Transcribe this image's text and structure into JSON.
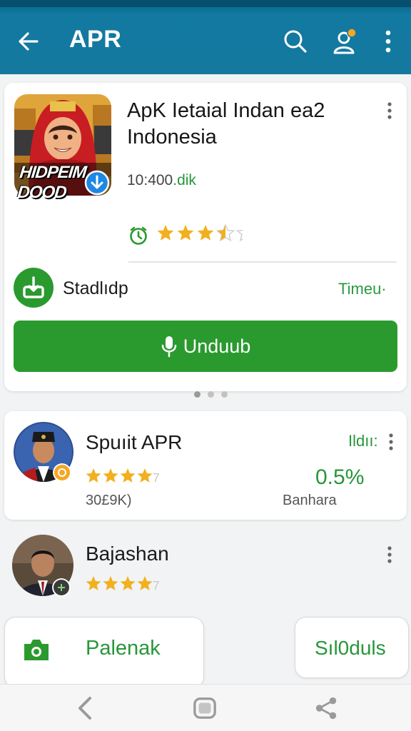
{
  "appbar": {
    "title": "APR",
    "icons": [
      "back-arrow-icon",
      "search-icon",
      "account-icon",
      "more-vert-icon"
    ],
    "color": "#15799f",
    "notification_dot_color": "#f5a623"
  },
  "app_card": {
    "icon_text": "HIDPEIM DOOD",
    "title": "ApK Ietaial Indan ea2 Indonesia",
    "size_number": "10:400",
    "size_suffix": ".dik",
    "rating_stars": 3.5,
    "download_label": "Stadlıdp",
    "time_label": "Timeu·",
    "button_label": "Unduub",
    "accent": "#2a9a2f"
  },
  "pager": {
    "count": 3,
    "active": 0
  },
  "publishers": [
    {
      "name": "Spuıit APR",
      "rating_stars": 4,
      "rating_suffix": "7",
      "count": "30£9K)",
      "tag": "Ildıı:",
      "percent": "0.5%",
      "source": "Banhara"
    },
    {
      "name": "Bajashan",
      "rating_stars": 4,
      "rating_suffix": "7"
    }
  ],
  "chips": [
    {
      "label": "Palenak",
      "icon": "camera-icon"
    },
    {
      "label": "Sıl0duls"
    }
  ],
  "navbar": {
    "icons": [
      "nav-back-icon",
      "nav-home-icon",
      "nav-share-icon"
    ]
  }
}
